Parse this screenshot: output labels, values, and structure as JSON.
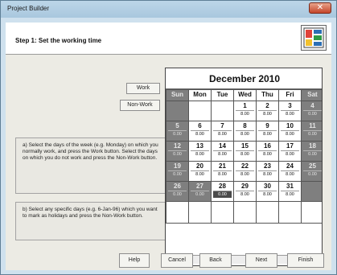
{
  "window": {
    "title": "Project Builder"
  },
  "header": {
    "step_text": "Step 1: Set the working time"
  },
  "side_buttons": {
    "work": "Work",
    "non_work": "Non-Work"
  },
  "instructions": [
    "a)  Select the days of the week (e.g. Monday) on which you normally work, and press the Work button. Select the days on which you do not work and press the Non-Work button.",
    "b)  Select any specific days (e.g. 6-Jan-96) which you want to mark as holidays and press the Non-Work button."
  ],
  "calendar": {
    "month_title": "December 2010",
    "headers": [
      "Sun",
      "Mon",
      "Tue",
      "Wed",
      "Thu",
      "Fri",
      "Sat"
    ],
    "rows": [
      [
        {
          "day": "",
          "hours": "",
          "weekend": true
        },
        {
          "day": "",
          "hours": "",
          "weekend": false
        },
        {
          "day": "",
          "hours": "",
          "weekend": false
        },
        {
          "day": "1",
          "hours": "8.00",
          "weekend": false
        },
        {
          "day": "2",
          "hours": "8.00",
          "weekend": false
        },
        {
          "day": "3",
          "hours": "8.00",
          "weekend": false
        },
        {
          "day": "4",
          "hours": "0.00",
          "weekend": true
        }
      ],
      [
        {
          "day": "5",
          "hours": "0.00",
          "weekend": true
        },
        {
          "day": "6",
          "hours": "8.00",
          "weekend": false
        },
        {
          "day": "7",
          "hours": "8.00",
          "weekend": false
        },
        {
          "day": "8",
          "hours": "8.00",
          "weekend": false
        },
        {
          "day": "9",
          "hours": "8.00",
          "weekend": false
        },
        {
          "day": "10",
          "hours": "8.00",
          "weekend": false
        },
        {
          "day": "11",
          "hours": "0.00",
          "weekend": true
        }
      ],
      [
        {
          "day": "12",
          "hours": "0.00",
          "weekend": true
        },
        {
          "day": "13",
          "hours": "8.00",
          "weekend": false
        },
        {
          "day": "14",
          "hours": "8.00",
          "weekend": false
        },
        {
          "day": "15",
          "hours": "8.00",
          "weekend": false
        },
        {
          "day": "16",
          "hours": "8.00",
          "weekend": false
        },
        {
          "day": "17",
          "hours": "8.00",
          "weekend": false
        },
        {
          "day": "18",
          "hours": "0.00",
          "weekend": true
        }
      ],
      [
        {
          "day": "19",
          "hours": "0.00",
          "weekend": true
        },
        {
          "day": "20",
          "hours": "8.00",
          "weekend": false
        },
        {
          "day": "21",
          "hours": "8.00",
          "weekend": false
        },
        {
          "day": "22",
          "hours": "8.00",
          "weekend": false
        },
        {
          "day": "23",
          "hours": "8.00",
          "weekend": false
        },
        {
          "day": "24",
          "hours": "8.00",
          "weekend": false
        },
        {
          "day": "25",
          "hours": "0.00",
          "weekend": true
        }
      ],
      [
        {
          "day": "26",
          "hours": "0.00",
          "weekend": true
        },
        {
          "day": "27",
          "hours": "0.00",
          "weekend": true
        },
        {
          "day": "28",
          "hours": "0.00",
          "weekend": false,
          "highlight": true
        },
        {
          "day": "29",
          "hours": "8.00",
          "weekend": false
        },
        {
          "day": "30",
          "hours": "8.00",
          "weekend": false
        },
        {
          "day": "31",
          "hours": "8.00",
          "weekend": false
        },
        {
          "day": "",
          "hours": "",
          "weekend": true
        }
      ]
    ]
  },
  "footer_buttons": {
    "help": "Help",
    "cancel": "Cancel",
    "back": "Back",
    "next": "Next",
    "finish": "Finish"
  },
  "icons": {
    "close": "close-icon",
    "logo": "project-builder-logo-icon",
    "scroll_left": "scroll-left-icon",
    "scroll_right": "scroll-right-icon"
  },
  "colors": {
    "titlebar": "#bcd6e8",
    "weekend_cell": "#7f7f7f",
    "close_button": "#c4452a"
  }
}
